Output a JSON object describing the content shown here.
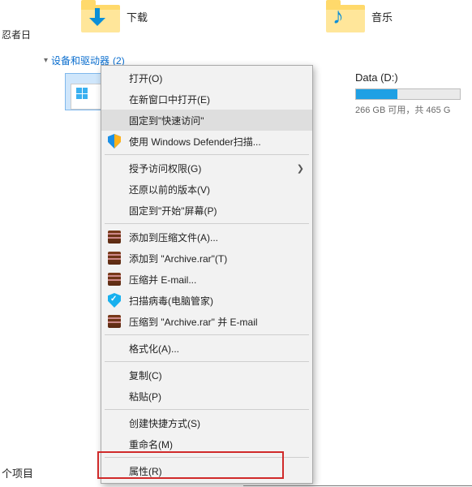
{
  "top": {
    "downloads_label": "下载",
    "music_label": "音乐"
  },
  "left_text": "忍者日",
  "section": {
    "title": "设备和驱动器",
    "count": "(2)"
  },
  "drive_d": {
    "label": "Data (D:)",
    "sub": "266 GB 可用，共 465 G"
  },
  "menu": {
    "open": "打开(O)",
    "open_new_window": "在新窗口中打开(E)",
    "pin_quick": "固定到\"快速访问\"",
    "defender": "使用 Windows Defender扫描...",
    "grant_access": "授予访问权限(G)",
    "previous_versions": "还原以前的版本(V)",
    "pin_start": "固定到\"开始\"屏幕(P)",
    "add_archive_a": "添加到压缩文件(A)...",
    "add_archive_t": "添加到 \"Archive.rar\"(T)",
    "compress_email": "压缩并 E-mail...",
    "scan_virus": "扫描病毒(电脑管家)",
    "compress_rar_email": "压缩到 \"Archive.rar\" 并 E-mail",
    "format": "格式化(A)...",
    "copy": "复制(C)",
    "paste": "粘贴(P)",
    "create_shortcut": "创建快捷方式(S)",
    "rename": "重命名(M)",
    "properties": "属性(R)"
  },
  "bottom_text": "个项目"
}
